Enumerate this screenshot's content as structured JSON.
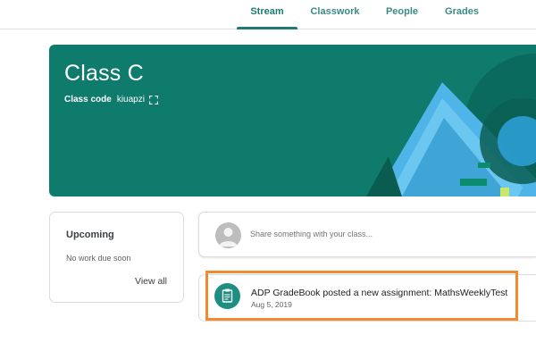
{
  "nav": {
    "tabs": [
      {
        "label": "Stream",
        "active": true
      },
      {
        "label": "Classwork",
        "active": false
      },
      {
        "label": "People",
        "active": false
      },
      {
        "label": "Grades",
        "active": false
      }
    ]
  },
  "banner": {
    "class_name": "Class C",
    "class_code_label": "Class code",
    "class_code": "kiuapzi",
    "expand_icon": "fullscreen-icon",
    "background_color": "#0f7b6c"
  },
  "upcoming": {
    "title": "Upcoming",
    "empty_text": "No work due soon",
    "view_all": "View all"
  },
  "share": {
    "placeholder": "Share something with your class..."
  },
  "post": {
    "title": "ADP GradeBook posted a new assignment: MathsWeeklyTest",
    "date": "Aug 5, 2019",
    "icon": "assignment-icon",
    "highlight_color": "#f28b30"
  }
}
